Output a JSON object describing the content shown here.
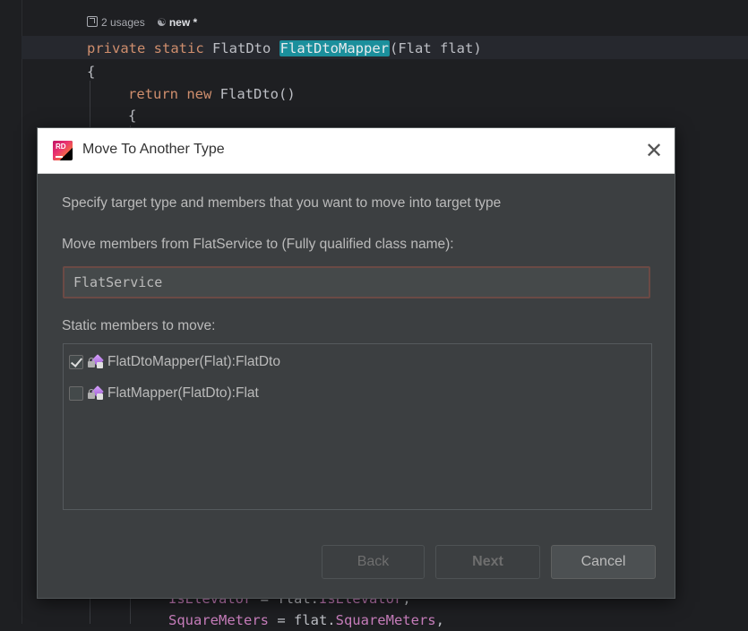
{
  "editor": {
    "hint": {
      "usages": "2 usages",
      "author": "new *"
    },
    "lines": {
      "l1": {
        "kw": "private static",
        "type": "FlatDto",
        "method": "FlatDtoMapper",
        "params": "(Flat flat)"
      },
      "l2": "{",
      "l3": {
        "kw": "return new",
        "rest": "FlatDto()"
      },
      "l4": "{",
      "l5": {
        "prop": "IsElevator",
        "rest": " = flat.",
        "prop2": "IsElevator",
        "end": ","
      },
      "l6": {
        "prop": "SquareMeters",
        "rest": " = flat.",
        "prop2": "SquareMeters",
        "end": ","
      }
    }
  },
  "dialog": {
    "title": "Move To Another Type",
    "app_icon_text": "RD",
    "close_glyph": "✕",
    "description": "Specify target type and members that you want to move into target type",
    "target_label": "Move members from FlatService to (Fully qualified class name):",
    "target_value": "FlatService",
    "members_label": "Static members to move:",
    "members": [
      {
        "label": "FlatDtoMapper(Flat):FlatDto",
        "checked": true
      },
      {
        "label": "FlatMapper(FlatDto):Flat",
        "checked": false
      }
    ],
    "buttons": {
      "back": "Back",
      "next": "Next",
      "cancel": "Cancel"
    }
  },
  "colors": {
    "editor_bg": "#1e1f22",
    "dialog_bg": "#3c3f41",
    "keyword": "#cf8e6d",
    "property": "#c77dbb",
    "highlight": "#1b8f9c",
    "input_error_border": "#6b4a45"
  }
}
